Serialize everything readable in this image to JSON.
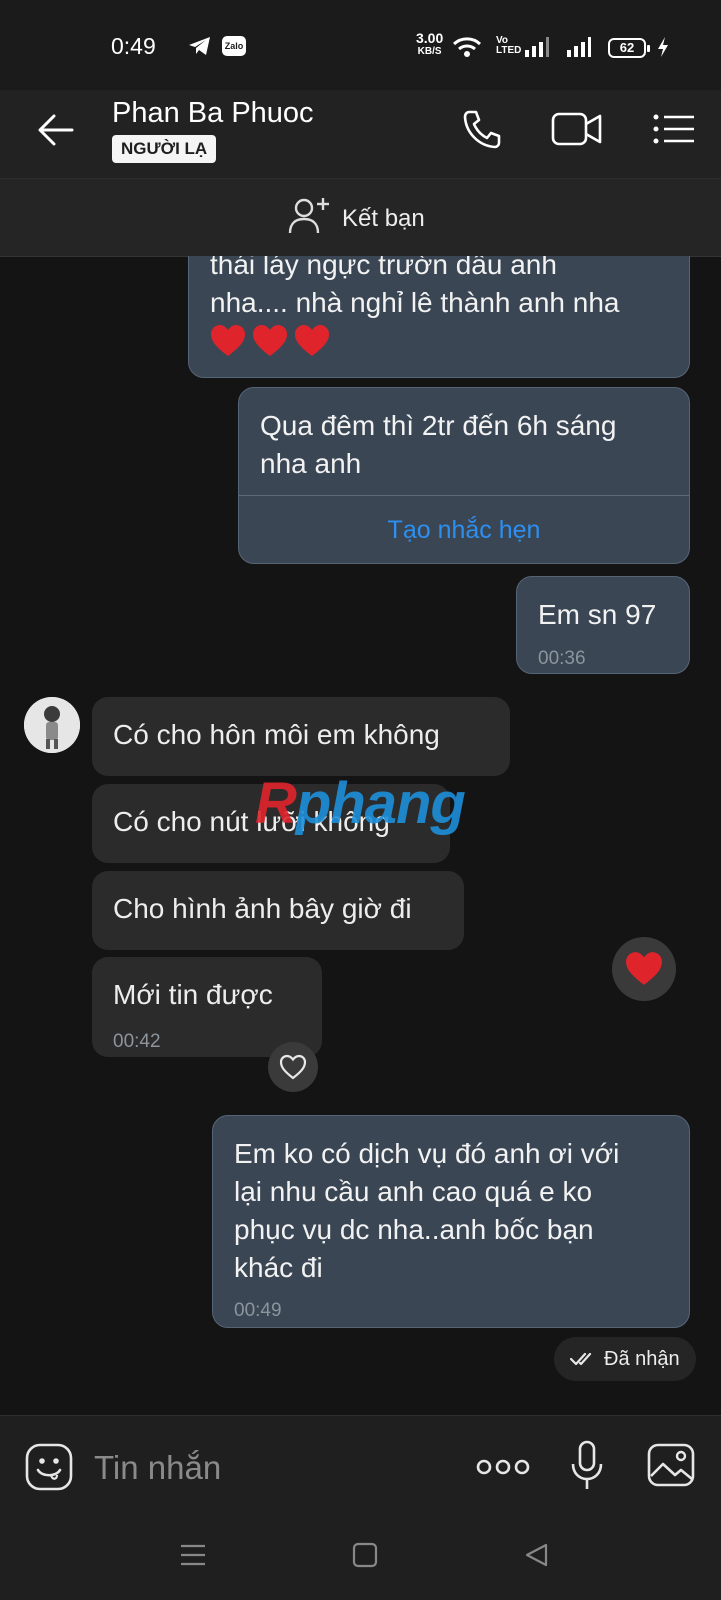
{
  "status_bar": {
    "time": "0:49",
    "net_speed_value": "3.00",
    "net_speed_unit": "KB/S",
    "volte_top": "Vo",
    "volte_bottom": "LTED",
    "battery": "62",
    "app_icons": [
      "telegram-icon",
      "zalo-icon"
    ]
  },
  "header": {
    "contact_name": "Phan Ba Phuoc",
    "badge": "NGƯỜI LẠ",
    "icons": [
      "back-arrow-icon",
      "phone-icon",
      "video-icon",
      "menu-icon"
    ]
  },
  "add_friend": {
    "label": "Kết bạn"
  },
  "messages": {
    "m1": {
      "direction": "outgoing",
      "line1": "thái láy ngực trườn dầu anh",
      "line2": "nha.... nhà nghỉ lê thành anh nha",
      "emoji": [
        "❤️",
        "❤️",
        "❤️"
      ]
    },
    "m2": {
      "direction": "outgoing",
      "line1": "Qua đêm thì 2tr đến 6h sáng",
      "line2": "nha anh",
      "action": "Tạo nhắc hẹn"
    },
    "m3": {
      "direction": "outgoing",
      "text": "Em sn 97",
      "time": "00:36"
    },
    "m4": {
      "direction": "incoming",
      "text": "Có cho hôn môi em không"
    },
    "m5": {
      "direction": "incoming",
      "text": "Có cho nút lưỡi không"
    },
    "m6": {
      "direction": "incoming",
      "text": "Cho hình ảnh bây giờ đi"
    },
    "m7": {
      "direction": "incoming",
      "text": "Mới tin được",
      "time": "00:42"
    },
    "m8": {
      "direction": "outgoing",
      "line1": "Em ko có dịch vụ đó anh ơi với",
      "line2": "lại nhu cầu anh cao quá e ko",
      "line3": "phục vụ dc nha..anh bốc bạn",
      "line4": "khác đi",
      "time": "00:49"
    }
  },
  "delivery_status": "Đã nhận",
  "watermark": {
    "part1": "R",
    "part2": "phang"
  },
  "input": {
    "placeholder": "Tin nhắn"
  },
  "colors": {
    "background": "#141414",
    "outgoing_bubble": "#3a4654",
    "incoming_bubble": "#2b2b2b",
    "link": "#2d8ff0",
    "heart": "#e0242c"
  }
}
